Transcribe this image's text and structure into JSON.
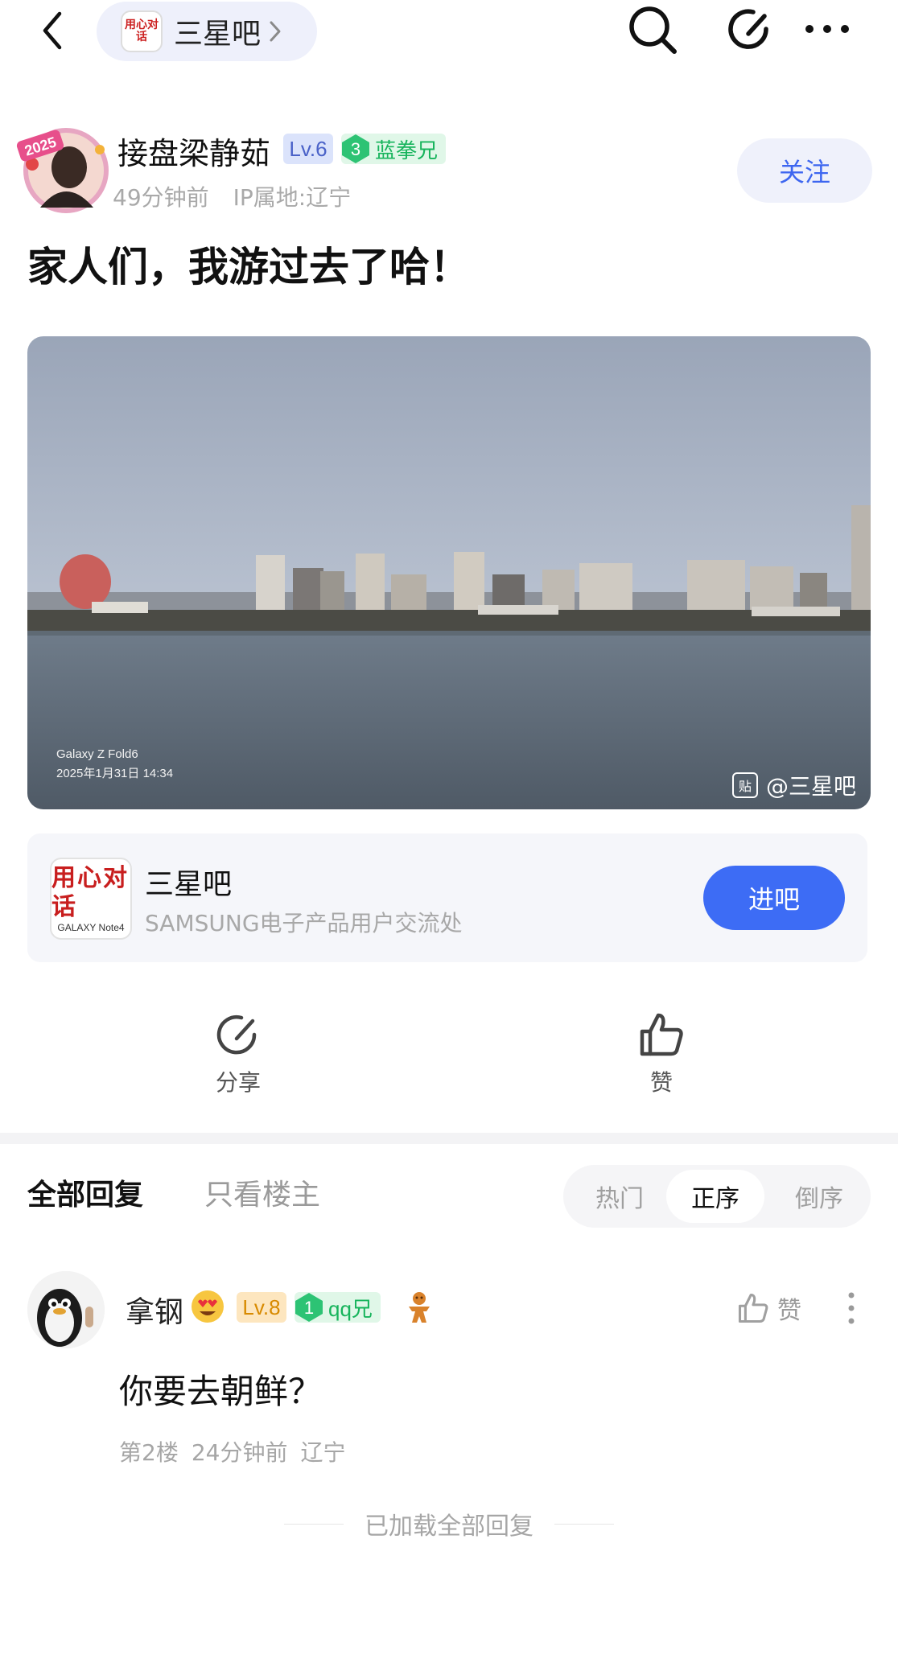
{
  "topbar": {
    "forum_name": "三星吧",
    "forum_logo_text": "用心对话"
  },
  "post": {
    "author": {
      "name": "接盘梁静茹",
      "level": "Lv.6",
      "title_level": "3",
      "title": "蓝拳兄",
      "avatar_badge": "2025"
    },
    "time": "49分钟前",
    "ip_location": "IP属地:辽宁",
    "follow_label": "关注",
    "title": "家人们，我游过去了哈！",
    "photo": {
      "camera": "Galaxy Z Fold6",
      "timestamp": "2025年1月31日 14:34",
      "watermark": "@三星吧"
    }
  },
  "forum_card": {
    "name": "三星吧",
    "description": "SAMSUNG电子产品用户交流处",
    "logo_text": "用心对话",
    "logo_sub": "GALAXY Note4",
    "enter_label": "进吧"
  },
  "actions": {
    "share_label": "分享",
    "like_label": "赞"
  },
  "replies": {
    "tab_all": "全部回复",
    "tab_op_only": "只看楼主",
    "sort_options": {
      "hot": "热门",
      "ascending": "正序",
      "descending": "倒序"
    },
    "selected_sort": "正序",
    "items": [
      {
        "name": "拿钢",
        "level": "Lv.8",
        "title_level": "1",
        "title": "qq兄",
        "content": "你要去朝鲜？",
        "floor": "第2楼",
        "time": "24分钟前",
        "location": "辽宁",
        "like_label": "赞"
      }
    ],
    "loaded_all": "已加载全部回复"
  },
  "colors": {
    "accent_blue": "#3d6cf5",
    "green_title": "#17b45c",
    "lv_blue_bg": "#dbe3fb",
    "lv_gold_bg": "#fde6bf"
  }
}
